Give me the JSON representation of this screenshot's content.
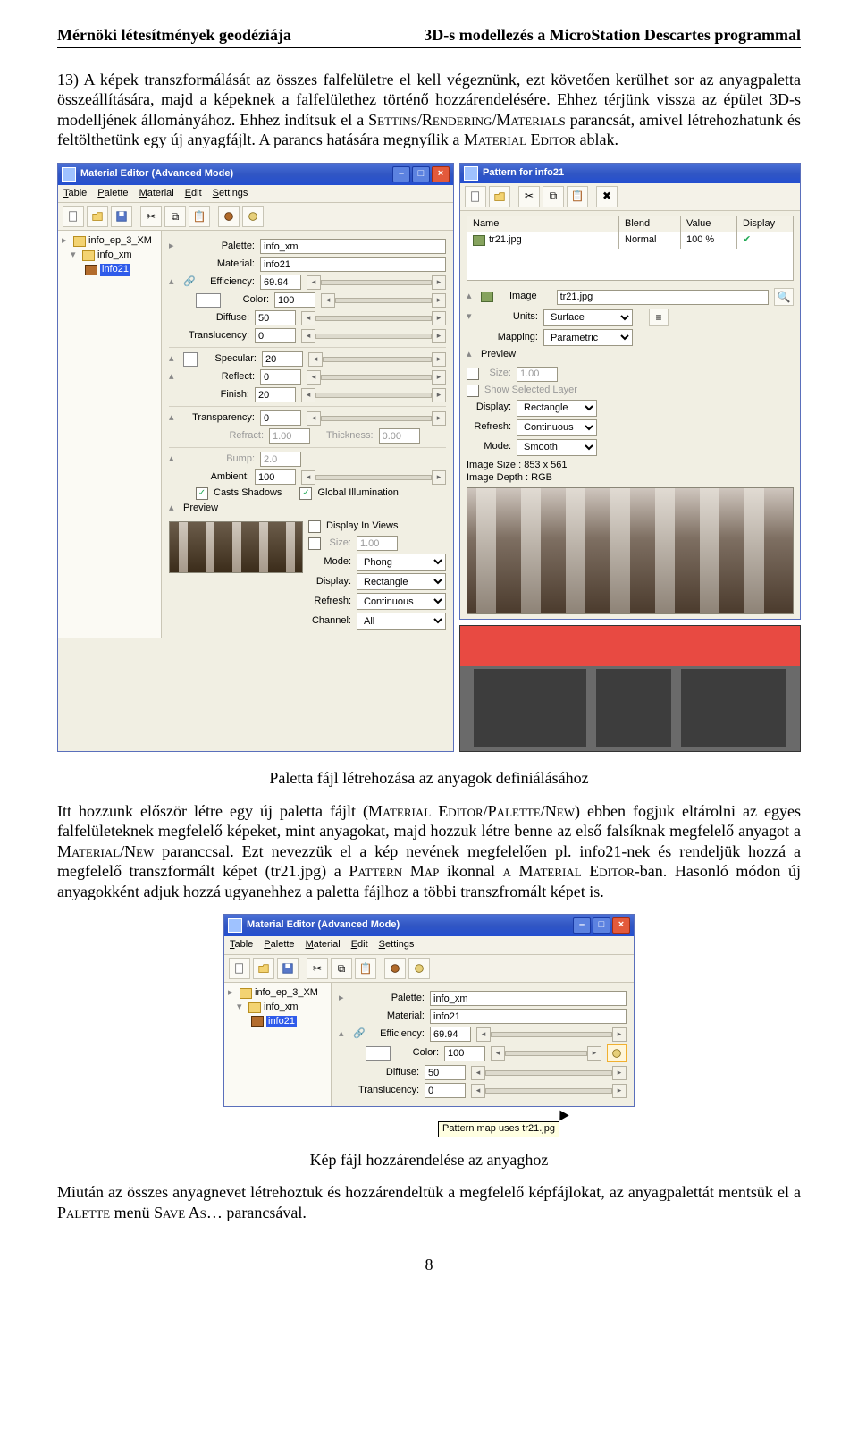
{
  "header": {
    "left": "Mérnöki létesítmények geodéziája",
    "right": "3D-s modellezés a MicroStation Descartes programmal"
  },
  "p1_a": "13) A képek transzformálását az összes falfelületre el kell végeznünk, ezt követően kerülhet sor az anyagpaletta összeállítására, majd a képeknek a falfelülethez történő hozzárendelésére. Ehhez térjünk vissza az épület 3D-s modelljének állományához. Ehhez indítsuk el a ",
  "p1_sc1": "Settins/Rendering/Materials",
  "p1_b": " parancsát, amivel létrehozhatunk és feltölthetünk egy új anyagfájlt. A parancs hatására megnyílik a ",
  "p1_sc2": "Material Editor",
  "p1_c": " ablak.",
  "caption1": "Paletta fájl létrehozása az anyagok definiálásához",
  "p2_a": "Itt hozzunk először létre egy új paletta fájlt (",
  "p2_sc1": "Material Editor/Palette/New",
  "p2_b": ") ebben fogjuk eltárolni az egyes falfelületeknek megfelelő képeket, mint anyagokat, majd hozzuk létre benne az első falsíknak megfelelő anyagot a ",
  "p2_sc2": "Material/New",
  "p2_c": " paranccsal. Ezt nevezzük el a kép nevének megfelelően pl. info21-nek és rendeljük hozzá a megfelelő transzformált képet (tr21.jpg) a ",
  "p2_sc3": "Pattern Map",
  "p2_d": " ikonnal ",
  "p2_sc4": "a Material Editor",
  "p2_e": "-ban. Hasonló módon új anyagokként adjuk hozzá ugyanehhez a paletta fájlhoz a többi transzfromált képet is.",
  "caption2": "Kép fájl hozzárendelése az anyaghoz",
  "p3_a": "Miután az összes anyagnevet létrehoztuk és hozzárendeltük a megfelelő képfájlokat, az anyagpalettát mentsük el a ",
  "p3_sc1": "Palette",
  "p3_b": " menü ",
  "p3_sc2": "Save As…",
  "p3_c": " parancsával.",
  "page_number": "8",
  "editor_title": "Material Editor (Advanced Mode)",
  "pattern_title": "Pattern for info21",
  "menu1": "Table",
  "menu2": "Palette",
  "menu3": "Material",
  "menu4": "Edit",
  "menu5": "Settings",
  "tree": {
    "root": "info_ep_3_XM",
    "pal": "info_xm",
    "mat": "info21"
  },
  "form": {
    "palette_lbl": "Palette:",
    "palette_val": "info_xm",
    "material_lbl": "Material:",
    "material_val": "info21",
    "efficiency_lbl": "Efficiency:",
    "efficiency_val": "69.94",
    "color_lbl": "Color:",
    "color_val": "100",
    "diffuse_lbl": "Diffuse:",
    "diffuse_val": "50",
    "translucency_lbl": "Translucency:",
    "translucency_val": "0",
    "specular_lbl": "Specular:",
    "specular_val": "20",
    "reflect_lbl": "Reflect:",
    "reflect_val": "0",
    "finish_lbl": "Finish:",
    "finish_val": "20",
    "transparency_lbl": "Transparency:",
    "transparency_val": "0",
    "refract_lbl": "Refract:",
    "refract_val": "1.00",
    "thickness_lbl": "Thickness:",
    "thickness_val": "0.00",
    "bump_lbl": "Bump:",
    "bump_val": "2.0",
    "ambient_lbl": "Ambient:",
    "ambient_val": "100",
    "casts_shadows": "Casts Shadows",
    "global_illum": "Global Illumination",
    "preview_lbl": "Preview",
    "display_in_views": "Display In Views",
    "size2_lbl": "Size:",
    "size2_val": "1.00",
    "mode_lbl": "Mode:",
    "mode_val": "Phong",
    "display_lbl": "Display:",
    "display_val": "Rectangle",
    "refresh_lbl": "Refresh:",
    "refresh_val": "Continuous",
    "channel_lbl": "Channel:",
    "channel_val": "All"
  },
  "pattern": {
    "hdr_name": "Name",
    "hdr_blend": "Blend",
    "hdr_value": "Value",
    "hdr_display": "Display",
    "row_name": "tr21.jpg",
    "row_blend": "Normal",
    "row_value": "100 %",
    "image_lbl": "Image",
    "image_val": "tr21.jpg",
    "units_lbl": "Units:",
    "units_val": "Surface",
    "mapping_lbl": "Mapping:",
    "mapping_val": "Parametric",
    "preview_lbl": "Preview",
    "size_lbl": "Size:",
    "size_val": "1.00",
    "show_sel_layer": "Show Selected Layer",
    "display_lbl": "Display:",
    "display_val": "Rectangle",
    "refresh_lbl": "Refresh:",
    "refresh_val": "Continuous",
    "mode_lbl": "Mode:",
    "mode_val": "Smooth",
    "img_size": "Image Size : 853 x 561",
    "img_depth": "Image Depth : RGB"
  },
  "form2": {
    "diffuse_val": "50",
    "translucency_val": "0",
    "color_val": "100",
    "efficiency_val": "69.94"
  },
  "tooltip_text": "Pattern map uses tr21.jpg"
}
